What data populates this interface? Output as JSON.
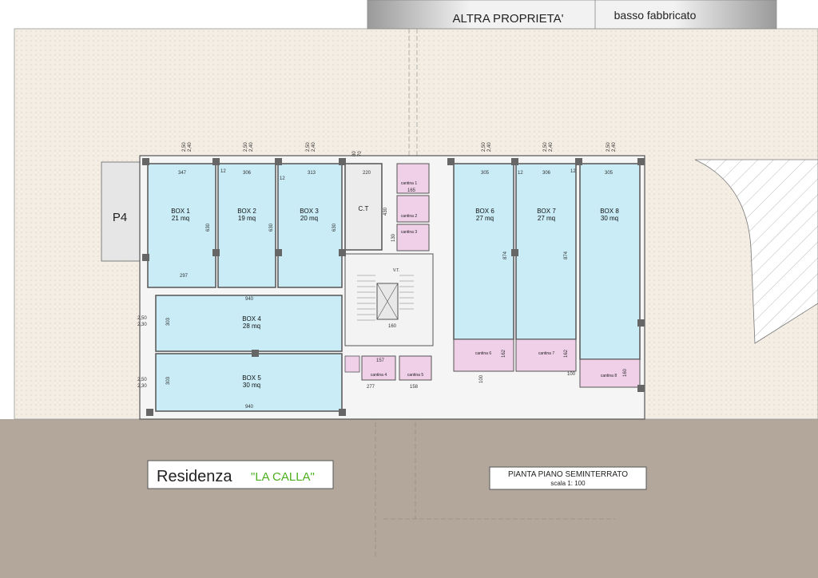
{
  "header": {
    "neighbor_label": "ALTRA PROPRIETA'",
    "neighbor_sub": "basso fabbricato"
  },
  "parking_label": "P4",
  "boxes": [
    {
      "name": "BOX 1",
      "area": "21 mq"
    },
    {
      "name": "BOX 2",
      "area": "19 mq"
    },
    {
      "name": "BOX 3",
      "area": "20 mq"
    },
    {
      "name": "BOX 4",
      "area": "28 mq"
    },
    {
      "name": "BOX 5",
      "area": "30 mq"
    },
    {
      "name": "BOX 6",
      "area": "27 mq"
    },
    {
      "name": "BOX 7",
      "area": "27 mq"
    },
    {
      "name": "BOX 8",
      "area": "30 mq"
    }
  ],
  "rooms": {
    "ct": "C.T",
    "vt": "V.T."
  },
  "cantine": [
    "cantina 1",
    "cantina 2",
    "cantina 3",
    "cantina 4",
    "cantina 5",
    "cantina 6",
    "cantina 7",
    "cantina 8"
  ],
  "dims": {
    "top_a": "2,50",
    "top_b": "2,40",
    "side_a": "2,50",
    "side_b": "2,30",
    "box1_w": "347",
    "box2_w": "306",
    "box3_w": "313",
    "ct_w": "220",
    "box6_w": "305",
    "box7_w": "306",
    "box8_w": "305",
    "box1_d": "630",
    "box1_bottom": "297",
    "box4_w": "940",
    "box5_w": "940",
    "box4_d": "303",
    "box5_d": "303",
    "box67_d": "874",
    "twelve": "12",
    "c4_w": "157",
    "c4_bottom": "277",
    "c5_w": "158",
    "c_top": "165",
    "stair": "160",
    "c6_d": "162",
    "c8_d": "160",
    "hundred": "100",
    "c_small": "130",
    "c_mid": "430",
    "eighty": "80",
    "seventy": "70"
  },
  "title": {
    "residenza": "Residenza",
    "name": "\"LA CALLA\"",
    "plan_title": "PIANTA PIANO SEMINTERRATO",
    "scale": "scala 1: 100"
  },
  "colors": {
    "box_fill": "#c9ecf7",
    "cantina_fill": "#f0cfe8",
    "ground": "#b3a69a",
    "paving": "#f1ebe2",
    "wall": "#555555",
    "accent_green": "#4caf1e"
  }
}
